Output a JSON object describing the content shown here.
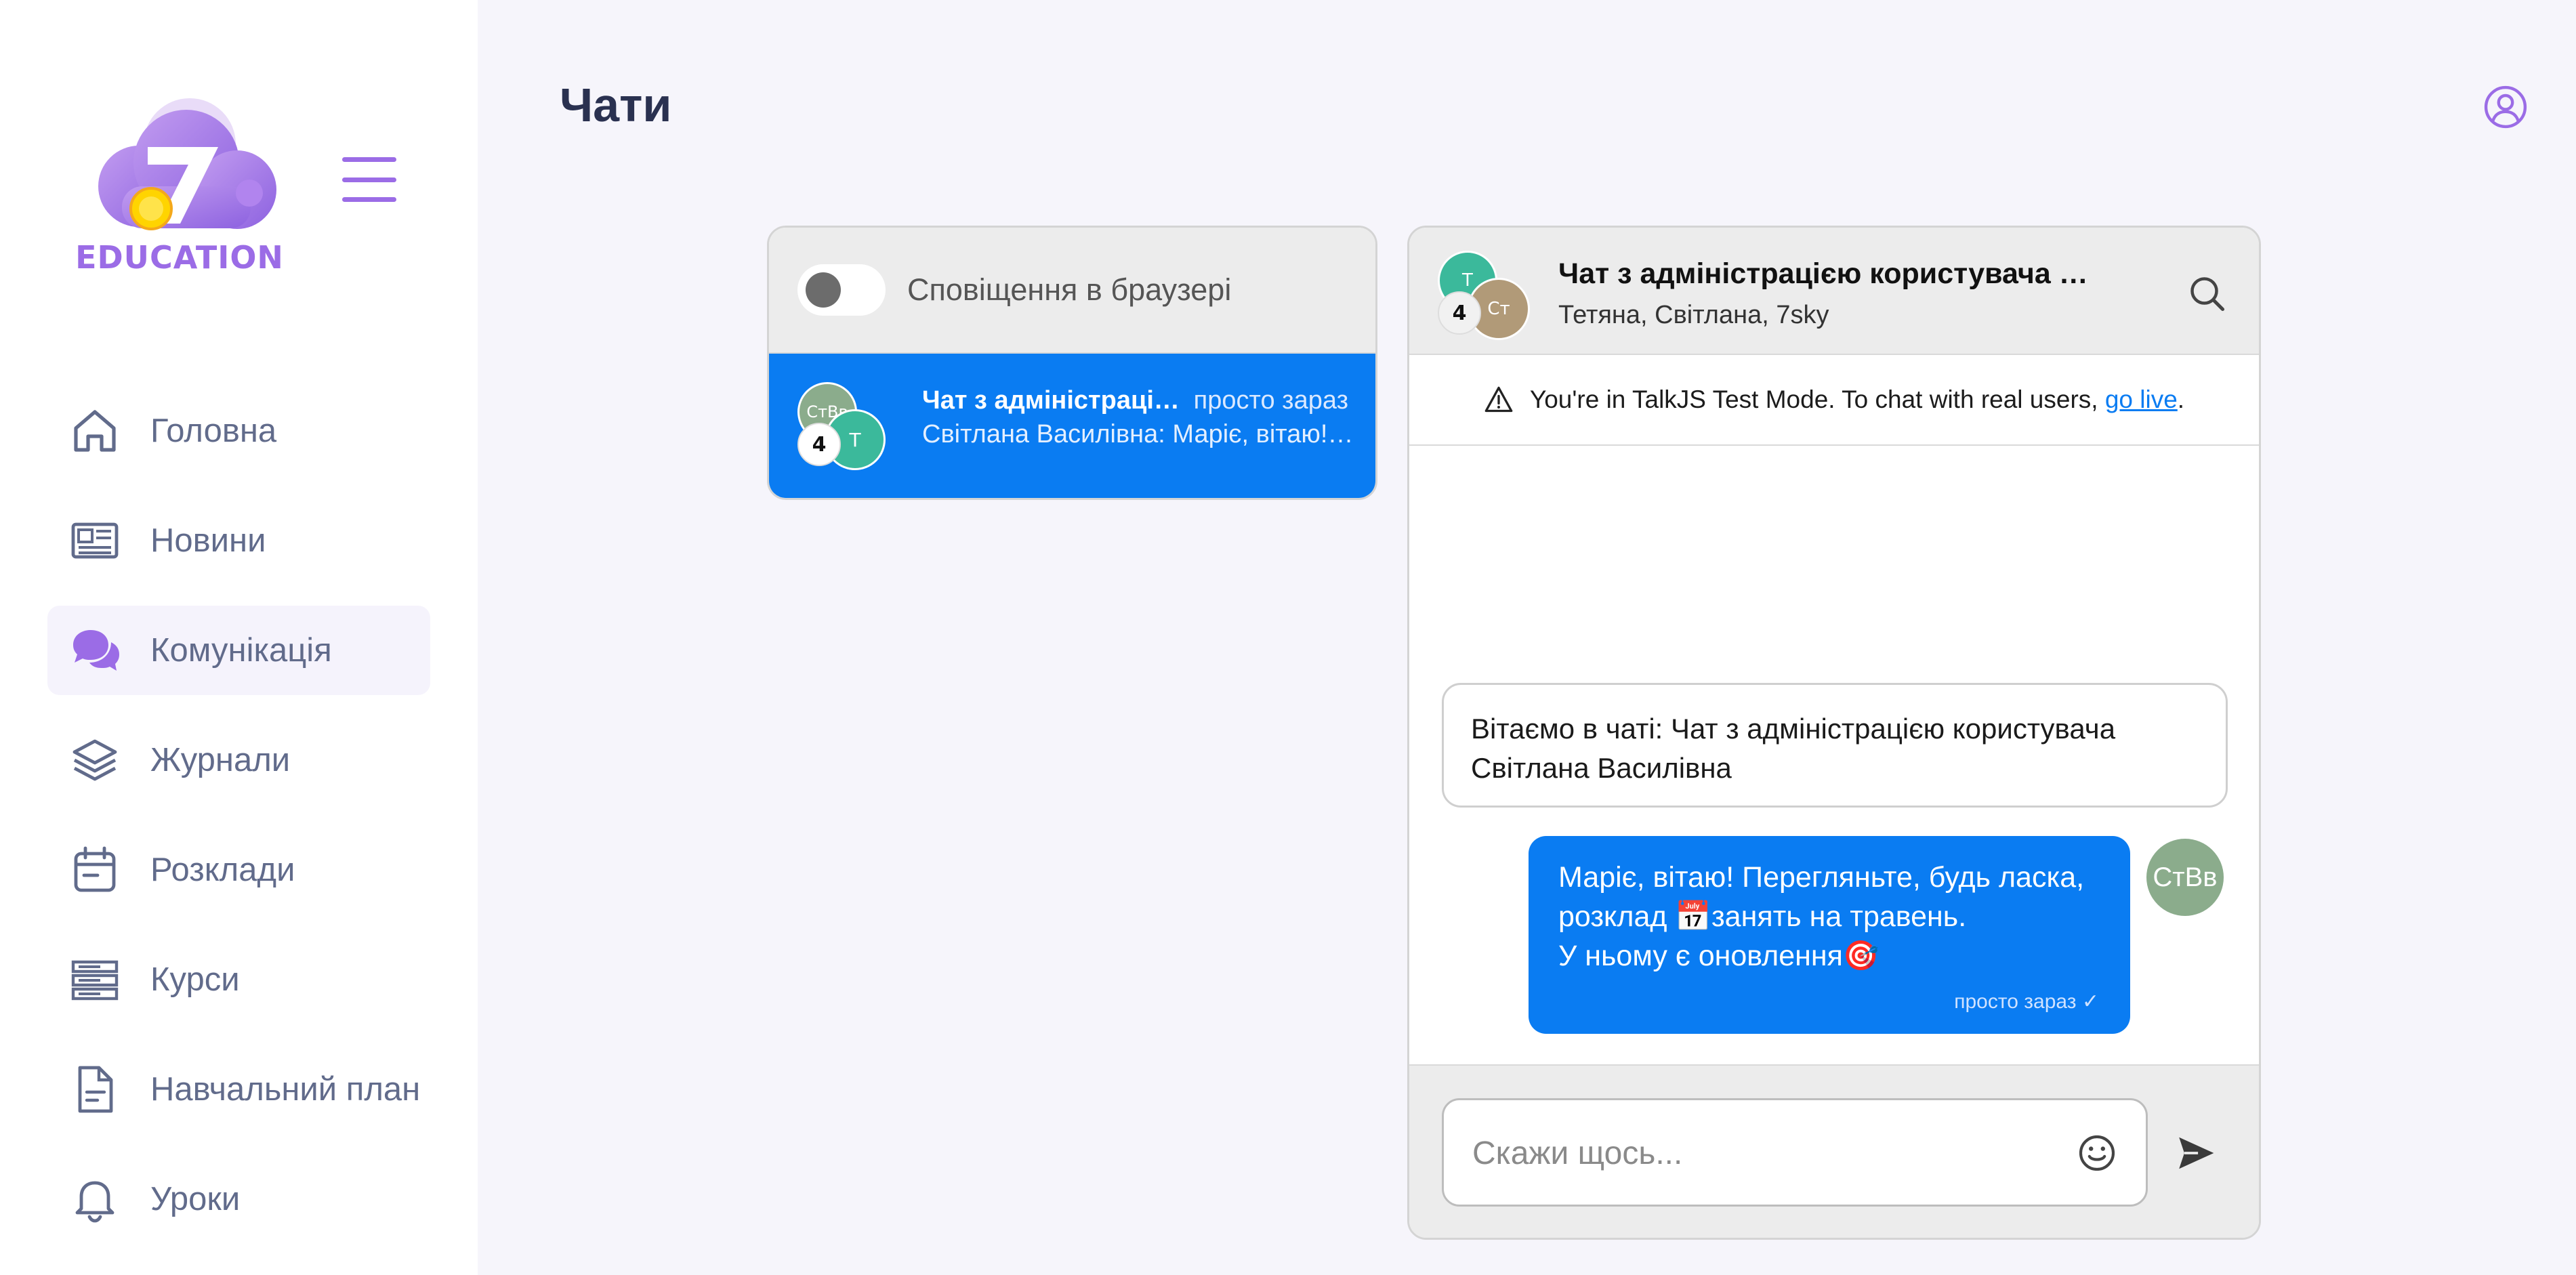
{
  "app": {
    "logo_text": "EDUCATION",
    "accent_color": "#9b6ce6"
  },
  "sidebar": {
    "items": [
      {
        "label": "Головна",
        "icon": "home-icon"
      },
      {
        "label": "Новини",
        "icon": "newspaper-icon"
      },
      {
        "label": "Комунікація",
        "icon": "chat-bubbles-icon",
        "active": true
      },
      {
        "label": "Журнали",
        "icon": "layers-icon"
      },
      {
        "label": "Розклади",
        "icon": "calendar-icon"
      },
      {
        "label": "Курси",
        "icon": "server-stack-icon"
      },
      {
        "label": "Навчальний план",
        "icon": "document-icon"
      },
      {
        "label": "Уроки",
        "icon": "bell-icon"
      }
    ]
  },
  "header": {
    "title": "Чати",
    "profile_icon": "user-circle-icon"
  },
  "conversation_list": {
    "notifications_label": "Сповіщення в браузері",
    "notifications_enabled": false,
    "conversations": [
      {
        "title": "Чат з адміністрацією користувача Світлана Василівна",
        "time": "просто зараз",
        "preview": "Світлана Василівна: Маріє, вітаю! Перегляньте, будь ласка, розклад занять на травень.",
        "avatar_a": "СтВв",
        "avatar_b": "Т",
        "participant_count": "4"
      }
    ]
  },
  "chat": {
    "title": "Чат з адміністрацією користувача Світлана Василівна",
    "subtitle": "Тетяна, Світлана, 7sky",
    "avatar_a": "Т",
    "avatar_b": "Ст",
    "participant_count": "4",
    "test_mode_text": "You're in TalkJS Test Mode. To chat with real users, ",
    "test_mode_link": "go live",
    "test_mode_end": ".",
    "welcome_text": "Вітаємо в чаті: Чат з адміністрацією користувача Світлана Василівна",
    "message": {
      "text": "Маріє, вітаю! Перегляньте, будь ласка, розклад 📅занять на травень.\nУ ньому є оновлення🎯",
      "time": "просто зараз ✓",
      "sender_initials": "СтВв"
    },
    "composer_placeholder": "Скажи щось..."
  },
  "colors": {
    "primary_blue": "#0a7cf2",
    "sidebar_text": "#616b8b",
    "avatar_teal": "#3bb99b",
    "avatar_tan": "#b19a78",
    "avatar_green": "#8bac8c"
  }
}
